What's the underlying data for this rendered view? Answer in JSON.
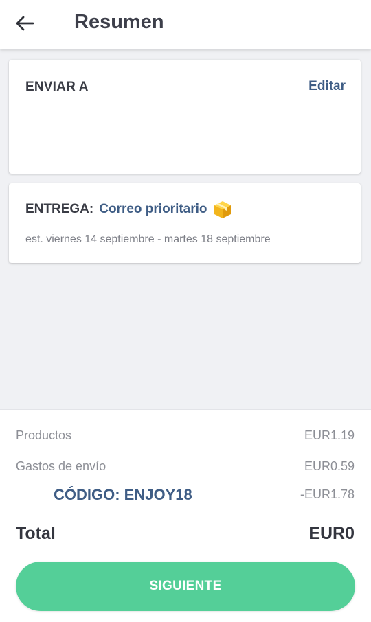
{
  "header": {
    "back_icon": "arrow-left-icon",
    "title": "Resumen"
  },
  "ship_card": {
    "label": "ENVIAR A",
    "edit_label": "Editar"
  },
  "delivery_card": {
    "label": "ENTREGA:",
    "method": "Correo prioritario",
    "method_icon": "package-icon",
    "estimate": "est. viernes 14 septiembre - martes 18 septiembre"
  },
  "summary": {
    "products_label": "Productos",
    "products_value": "EUR1.19",
    "shipping_label": "Gastos de envío",
    "shipping_value": "EUR0.59",
    "code_label": "CÓDIGO: ENJOY18",
    "code_value": "-EUR1.78",
    "total_label": "Total",
    "total_value": "EUR0"
  },
  "next_button": {
    "label": "SIGUIENTE"
  },
  "colors": {
    "accent_blue": "#3f5d85",
    "button_green": "#54cf98",
    "background": "#f0f1f4"
  }
}
